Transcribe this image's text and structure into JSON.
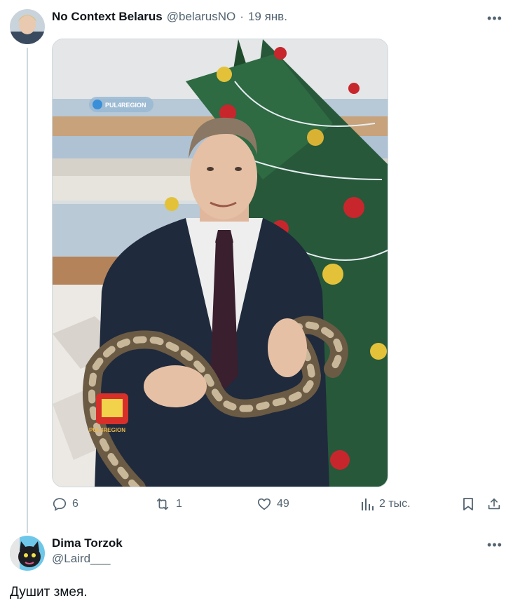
{
  "tweet": {
    "author_name": "No Context Belarus",
    "author_handle": "@belarusNO",
    "separator": "·",
    "date": "19 янв.",
    "avatar_icon": "avatar-photo",
    "media": {
      "watermark_top": "PUL4REGION",
      "watermark_bottom": "PUL4REGION"
    },
    "actions": {
      "replies": "6",
      "reposts": "1",
      "likes": "49",
      "views": "2 тыс."
    }
  },
  "reply": {
    "author_name": "Dima Torzok",
    "author_handle": "@Laird___",
    "text": "Душит змея.",
    "avatar_icon": "cat-avatar"
  },
  "colors": {
    "text_primary": "#0f1419",
    "text_muted": "#536471",
    "border": "#cfd9de"
  }
}
